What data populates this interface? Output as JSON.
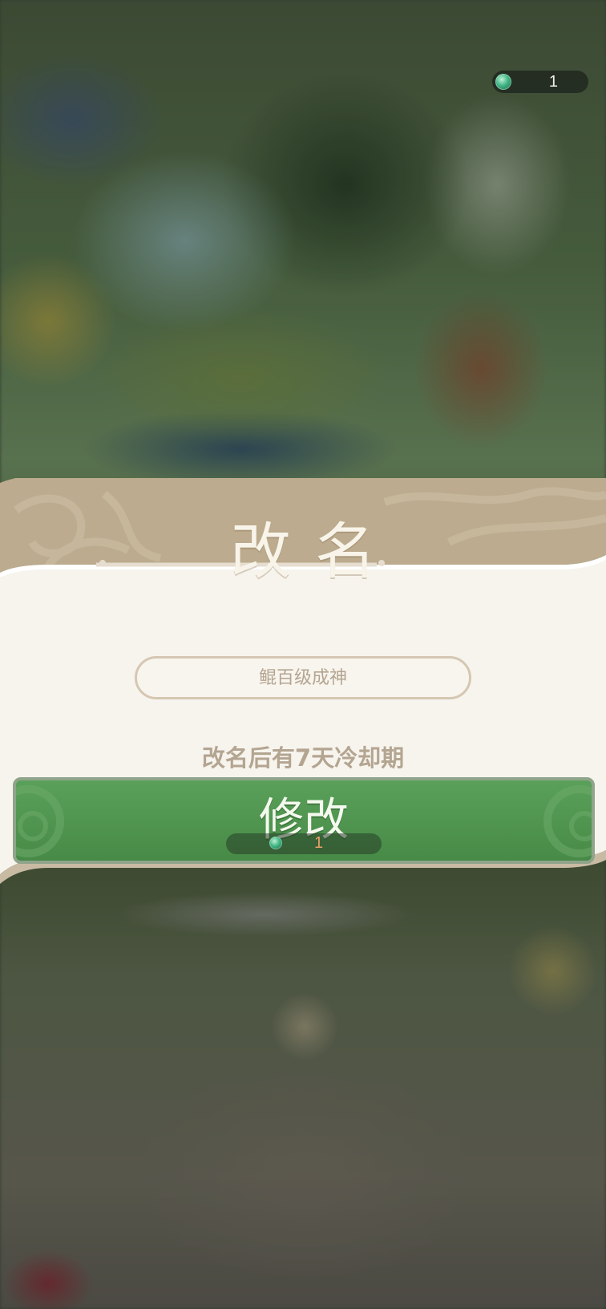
{
  "top_bar": {
    "currency_icon": "jade-gem-icon",
    "currency_amount": "1"
  },
  "dialog": {
    "title": "改名",
    "name_input": {
      "value": "",
      "placeholder": "鲲百级成神"
    },
    "cooldown_note": "改名后有7天冷却期",
    "confirm_button": {
      "label": "修改",
      "cost_icon": "jade-gem-icon",
      "cost_amount": "1"
    }
  },
  "colors": {
    "panel_header": "#bcab8e",
    "panel_body": "#f7f4ee",
    "button_green": "#519751",
    "muted_text": "#b4a591",
    "cost_text": "#e8a06a"
  }
}
